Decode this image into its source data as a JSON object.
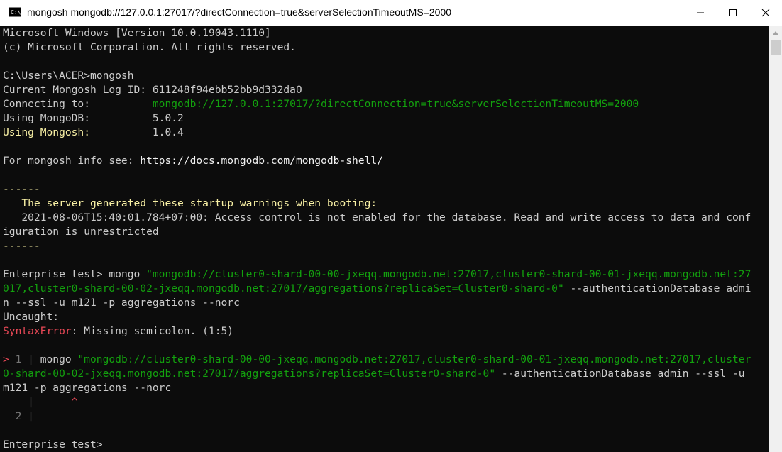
{
  "window": {
    "title": "mongosh mongodb://127.0.0.1:27017/?directConnection=true&serverSelectionTimeoutMS=2000",
    "icon": "cmd-icon",
    "icon_text": "C:\\"
  },
  "terminal": {
    "l1": "Microsoft Windows [Version 10.0.19043.1110]",
    "l2": "(c) Microsoft Corporation. All rights reserved.",
    "l3": "C:\\Users\\ACER>mongosh",
    "l4": "Current Mongosh Log ID: 611248f94ebb52bb9d332da0",
    "l5_label": "Connecting to:          ",
    "l5_value": "mongodb://127.0.0.1:27017/?directConnection=true&serverSelectionTimeoutMS=2000",
    "l6_label": "Using MongoDB:          ",
    "l6_value": "5.0.2",
    "l7_label": "Using Mongosh:",
    "l7_pad": "          ",
    "l7_value": "1.0.4",
    "l8_label": "For mongosh info see: ",
    "l8_value": "https://docs.mongodb.com/mongodb-shell/",
    "l9": "------",
    "l10": "   The server generated these startup warnings when booting:",
    "l11": "   2021-08-06T15:40:01.784+07:00: Access control is not enabled for the database. Read and write access to data and conf",
    "l12": "iguration is unrestricted",
    "l13": "------",
    "l14_prompt": "Enterprise test> ",
    "l14_cmd": "mongo ",
    "l14_str": "\"mongodb://cluster0-shard-00-00-jxeqq.mongodb.net:27017,cluster0-shard-00-01-jxeqq.mongodb.net:27",
    "l15_str": "017,cluster0-shard-00-02-jxeqq.mongodb.net:27017/aggregations?replicaSet=Cluster0-shard-0\"",
    "l15_rest": " --authenticationDatabase admi",
    "l16": "n --ssl -u m121 -p aggregations --norc",
    "l17": "Uncaught:",
    "l18_err": "SyntaxError",
    "l18_msg": ": Missing semicolon. (1:5)",
    "l19_marker": "> ",
    "l19_gutter": "1 | ",
    "l19_cmd": "mongo ",
    "l19_str": "\"mongodb://cluster0-shard-00-00-jxeqq.mongodb.net:27017,cluster0-shard-00-01-jxeqq.mongodb.net:27017,cluster",
    "l20_str": "0-shard-00-02-jxeqq.mongodb.net:27017/aggregations?replicaSet=Cluster0-shard-0\"",
    "l20_rest": " --authenticationDatabase admin --ssl -u",
    "l21": "m121 -p aggregations --norc",
    "l22_gutter": "    |",
    "l22_pad": "      ",
    "l22_caret": "^",
    "l23_gutter": "  2 |",
    "l24": "Enterprise test> "
  },
  "colors": {
    "background": "#0c0c0c",
    "text": "#cccccc",
    "green": "#13a10e",
    "yellow": "#f9f1a5",
    "red": "#e74856"
  }
}
